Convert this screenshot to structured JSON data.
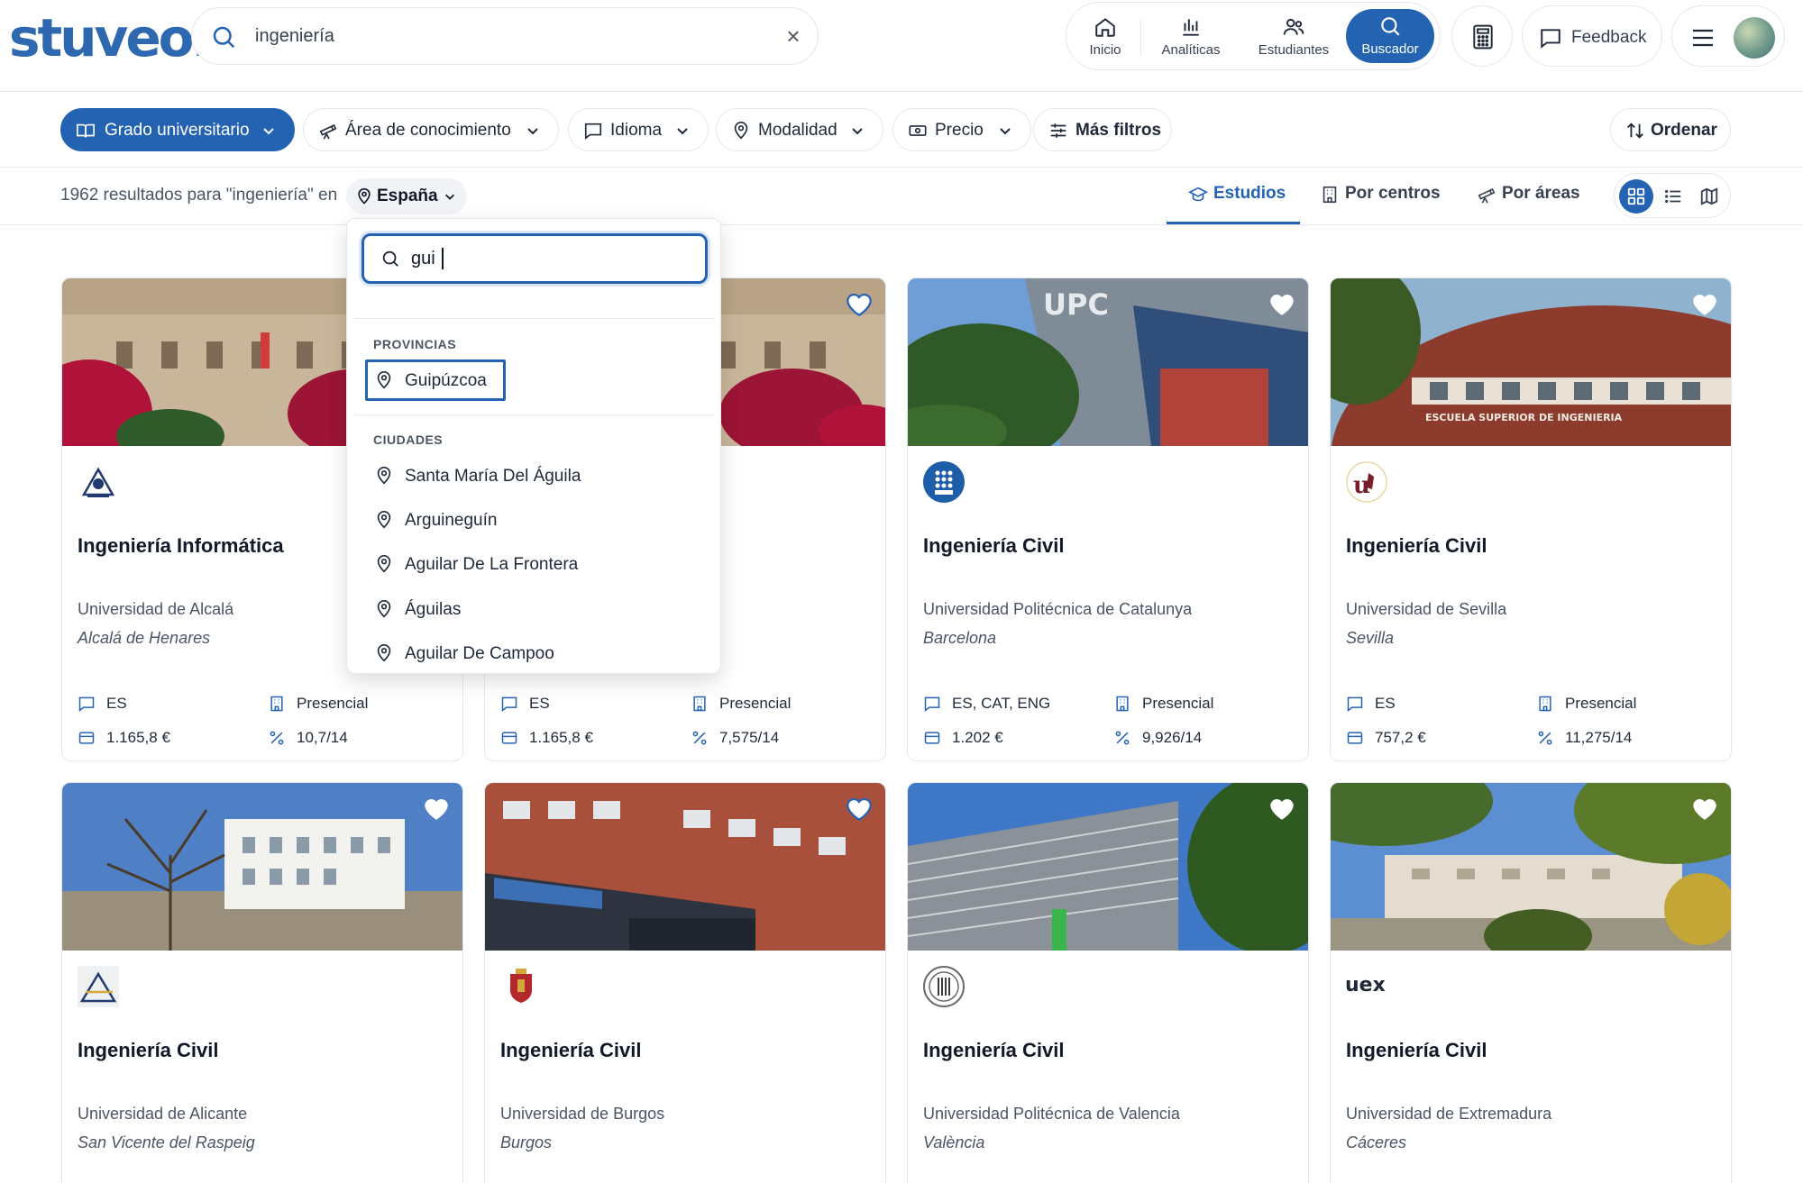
{
  "header": {
    "logo": "stuveo.",
    "search": {
      "value": "ingeniería"
    },
    "nav": {
      "inicio": "Inicio",
      "analiticas": "Analíticas",
      "estudiantes": "Estudiantes",
      "buscador": "Buscador"
    },
    "feedback": "Feedback"
  },
  "filters": {
    "grado": "Grado universitario",
    "area": "Área de conocimiento",
    "idioma": "Idioma",
    "modalidad": "Modalidad",
    "precio": "Precio",
    "mas": "Más filtros",
    "ordenar": "Ordenar"
  },
  "results": {
    "text": "1962 resultados para \"ingeniería\" en",
    "country": "España"
  },
  "view_tabs": {
    "estudios": "Estudios",
    "centros": "Por centros",
    "areas": "Por áreas"
  },
  "location_dropdown": {
    "query": "gui",
    "provincias_label": "PROVINCIAS",
    "provincias": [
      "Guipúzcoa"
    ],
    "ciudades_label": "CIUDADES",
    "ciudades": [
      "Santa María Del Águila",
      "Arguineguín",
      "Aguilar De La Frontera",
      "Águilas",
      "Aguilar De Campoo"
    ]
  },
  "cards": [
    {
      "title": "Ingeniería Informática",
      "university": "Universidad de Alcalá",
      "city": "Alcalá de Henares",
      "languages": "ES",
      "modality": "Presencial",
      "price": "1.165,8 €",
      "grade": "10,7/14"
    },
    {
      "title": "",
      "university": "",
      "city": "",
      "languages": "ES",
      "modality": "Presencial",
      "price": "1.165,8 €",
      "grade": "7,575/14"
    },
    {
      "title": "Ingeniería Civil",
      "university": "Universidad Politécnica de Catalunya",
      "city": "Barcelona",
      "languages": "ES, CAT, ENG",
      "modality": "Presencial",
      "price": "1.202 €",
      "grade": "9,926/14",
      "image_text": "UPC"
    },
    {
      "title": "Ingeniería Civil",
      "university": "Universidad de Sevilla",
      "city": "Sevilla",
      "languages": "ES",
      "modality": "Presencial",
      "price": "757,2 €",
      "grade": "11,275/14",
      "image_text": "ESCUELA SUPERIOR DE INGENIERIA"
    },
    {
      "title": "Ingeniería Civil",
      "university": "Universidad de Alicante",
      "city": "San Vicente del Raspeig"
    },
    {
      "title": "Ingeniería Civil",
      "university": "Universidad de Burgos",
      "city": "Burgos"
    },
    {
      "title": "Ingeniería Civil",
      "university": "Universidad Politécnica de Valencia",
      "city": "València"
    },
    {
      "title": "Ingeniería Civil",
      "university": "Universidad de Extremadura",
      "city": "Cáceres",
      "logo_text": "uex"
    }
  ],
  "colors": {
    "primary": "#2463b2",
    "border": "#e5e7eb",
    "text": "#1f2937"
  }
}
